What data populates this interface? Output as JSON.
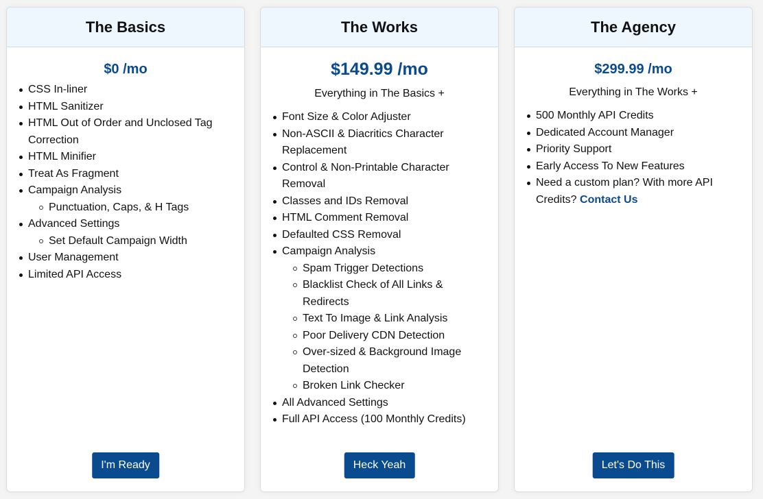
{
  "plans": [
    {
      "name": "The Basics",
      "price": "$0 /mo",
      "features": [
        {
          "label": "CSS In-liner"
        },
        {
          "label": "HTML Sanitizer"
        },
        {
          "label": "HTML Out of Order and Unclosed Tag Correction"
        },
        {
          "label": "HTML Minifier"
        },
        {
          "label": "Treat As Fragment"
        },
        {
          "label": "Campaign Analysis",
          "sub": [
            "Punctuation, Caps, & H Tags"
          ]
        },
        {
          "label": "Advanced Settings",
          "sub": [
            "Set Default Campaign Width"
          ]
        },
        {
          "label": "User Management"
        },
        {
          "label": "Limited API Access"
        }
      ],
      "button": "I'm Ready"
    },
    {
      "name": "The Works",
      "price": "$149.99 /mo",
      "subtitle": "Everything in The Basics +",
      "features": [
        {
          "label": "Font Size & Color Adjuster"
        },
        {
          "label": "Non-ASCII & Diacritics Character Replacement"
        },
        {
          "label": "Control & Non-Printable Character Removal"
        },
        {
          "label": "Classes and IDs Removal"
        },
        {
          "label": "HTML Comment Removal"
        },
        {
          "label": "Defaulted CSS Removal"
        },
        {
          "label": "Campaign Analysis",
          "sub": [
            "Spam Trigger Detections",
            "Blacklist Check of All Links & Redirects",
            "Text To Image & Link Analysis",
            "Poor Delivery CDN Detection",
            "Over-sized & Background Image Detection",
            "Broken Link Checker"
          ]
        },
        {
          "label": "All Advanced Settings"
        },
        {
          "label": "Full API Access (100 Monthly Credits)"
        }
      ],
      "button": "Heck Yeah"
    },
    {
      "name": "The Agency",
      "price": "$299.99 /mo",
      "subtitle": "Everything in The Works +",
      "features": [
        {
          "label": "500 Monthly API Credits"
        },
        {
          "label": "Dedicated Account Manager"
        },
        {
          "label": "Priority Support"
        },
        {
          "label": "Early Access To New Features"
        },
        {
          "label": "Need a custom plan? With more API Credits?",
          "link": "Contact Us"
        }
      ],
      "button": "Let's Do This"
    }
  ],
  "colors": {
    "accent": "#0a4a8e",
    "header_bg": "#eef6fe",
    "page_bg": "#f4f4f4"
  }
}
